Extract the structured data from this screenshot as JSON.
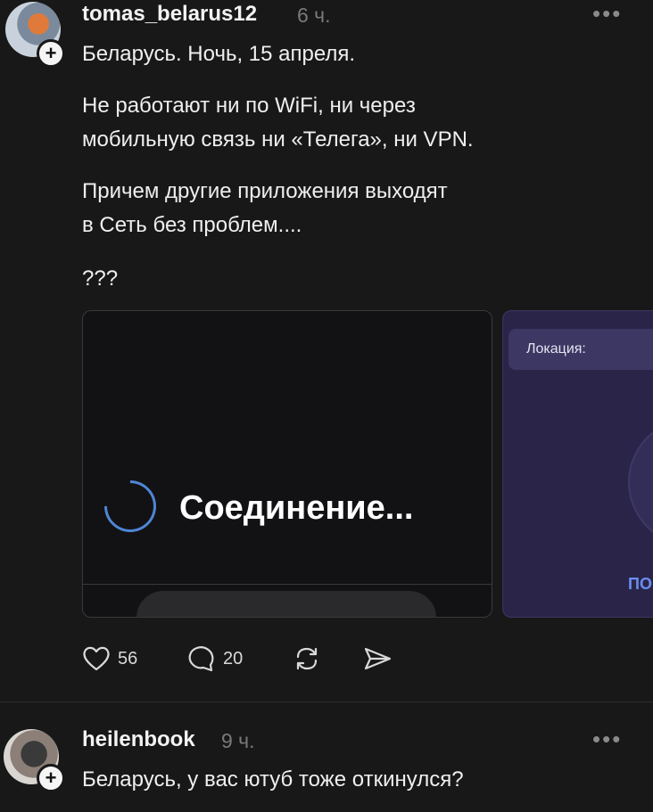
{
  "post1": {
    "username": "tomas_belarus12",
    "time": "6 ч.",
    "more": "•••",
    "lines": [
      "Беларусь. Ночь, 15 апреля.",
      "Не работают ни по WiFi, ни через",
      "мобильную связь ни «Телега», ни VPN.",
      "Причем другие приложения выходят",
      "в Сеть без проблем....",
      "???"
    ],
    "media": {
      "connecting_text": "Соединение...",
      "location_label": "Локация:",
      "partial_link_text": "ПО"
    },
    "actions": {
      "likes": "56",
      "comments": "20"
    }
  },
  "post2": {
    "username": "heilenbook",
    "time": "9 ч.",
    "more": "•••",
    "text": "Беларусь, у вас ютуб тоже откинулся?"
  },
  "colors": {
    "background": "#181818",
    "spinner": "#4f86d6",
    "vpn_card": "#2a2548"
  }
}
